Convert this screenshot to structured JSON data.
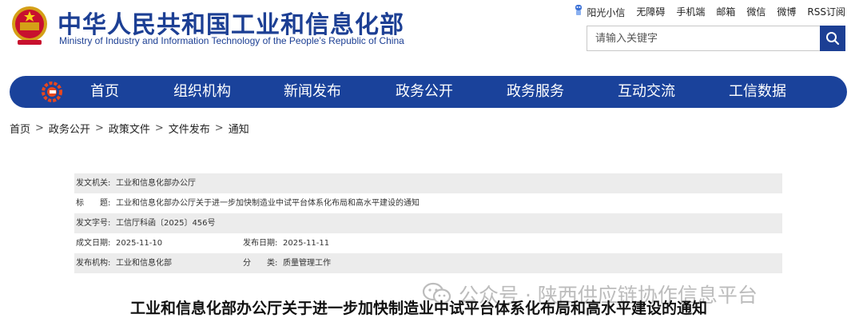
{
  "site": {
    "title": "中华人民共和国工业和信息化部",
    "subtitle": "Ministry of Industry and Information Technology of the People’s Republic of China"
  },
  "toplinks": [
    "阳光小信",
    "无障碍",
    "手机端",
    "邮箱",
    "微信",
    "微博",
    "RSS订阅"
  ],
  "search": {
    "placeholder": "请输入关键字"
  },
  "nav": [
    "首页",
    "组织机构",
    "新闻发布",
    "政务公开",
    "政务服务",
    "互动交流",
    "工信数据"
  ],
  "breadcrumb": [
    "首页",
    "政务公开",
    "政策文件",
    "文件发布",
    "通知"
  ],
  "meta": {
    "issuer_label": "发文机关:",
    "issuer": "工业和信息化部办公厅",
    "title_label": "标　　题:",
    "title": "工业和信息化部办公厅关于进一步加快制造业中试平台体系化布局和高水平建设的通知",
    "doc_no_label": "发文字号:",
    "doc_no": "工信厅科函〔2025〕456号",
    "created_label": "成文日期:",
    "created": "2025-11-10",
    "published_label": "发布日期:",
    "published": "2025-11-11",
    "org_label": "发布机构:",
    "org": "工业和信息化部",
    "category_label": "分　　类:",
    "category": "质量管理工作"
  },
  "article": {
    "title": "工业和信息化部办公厅关于进一步加快制造业中试平台体系化布局和高水平建设的通知"
  },
  "watermark": {
    "text": "公众号 · 陕西供应链协作信息平台"
  },
  "colors": {
    "brand": "#1a429b",
    "meta_shade": "#ececec"
  }
}
